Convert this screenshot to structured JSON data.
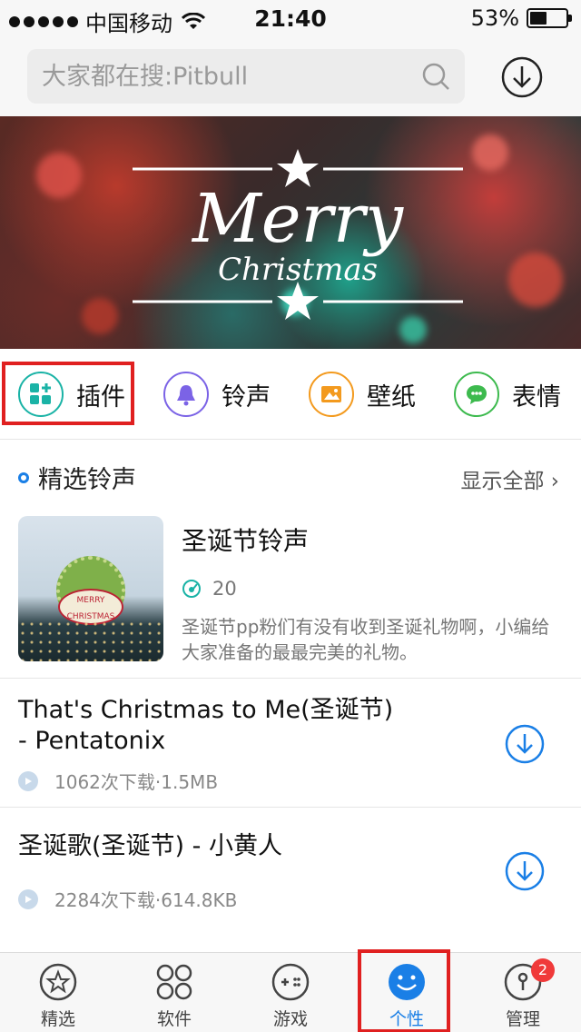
{
  "status_bar": {
    "carrier": "中国移动",
    "time": "21:40",
    "battery": "53%",
    "battery_level": 0.53
  },
  "search": {
    "placeholder": "大家都在搜:Pitbull"
  },
  "banner": {
    "title": "Merry",
    "subtitle": "Christmas"
  },
  "categories": [
    {
      "label": "插件",
      "icon": "plugin-icon",
      "color": "#1ab3a6"
    },
    {
      "label": "铃声",
      "icon": "bell-icon",
      "color": "#7b63e6"
    },
    {
      "label": "壁纸",
      "icon": "wallpaper-icon",
      "color": "#f39a1e"
    },
    {
      "label": "表情",
      "icon": "emoji-icon",
      "color": "#3dba4e"
    }
  ],
  "section": {
    "title": "精选铃声",
    "show_all": "显示全部"
  },
  "featured": {
    "title": "圣诞节铃声",
    "count": "20",
    "description": "圣诞节pp粉们有没有收到圣诞礼物啊，小编给大家准备的最最完美的礼物。",
    "thumb_text": "MERRY CHRISTMAS"
  },
  "songs": [
    {
      "name": "That's Christmas to Me(圣诞节) - Pentatonix",
      "meta": "1062次下载·1.5MB"
    },
    {
      "name": "圣诞歌(圣诞节) - 小黄人",
      "meta": "2284次下载·614.8KB"
    }
  ],
  "tabs": [
    {
      "label": "精选",
      "icon": "star-icon"
    },
    {
      "label": "软件",
      "icon": "apps-icon"
    },
    {
      "label": "游戏",
      "icon": "gamepad-icon"
    },
    {
      "label": "个性",
      "icon": "smiley-icon"
    },
    {
      "label": "管理",
      "icon": "manage-icon",
      "badge": "2"
    }
  ],
  "accent_color": "#1a7fe6",
  "highlight_color": "#e02020"
}
